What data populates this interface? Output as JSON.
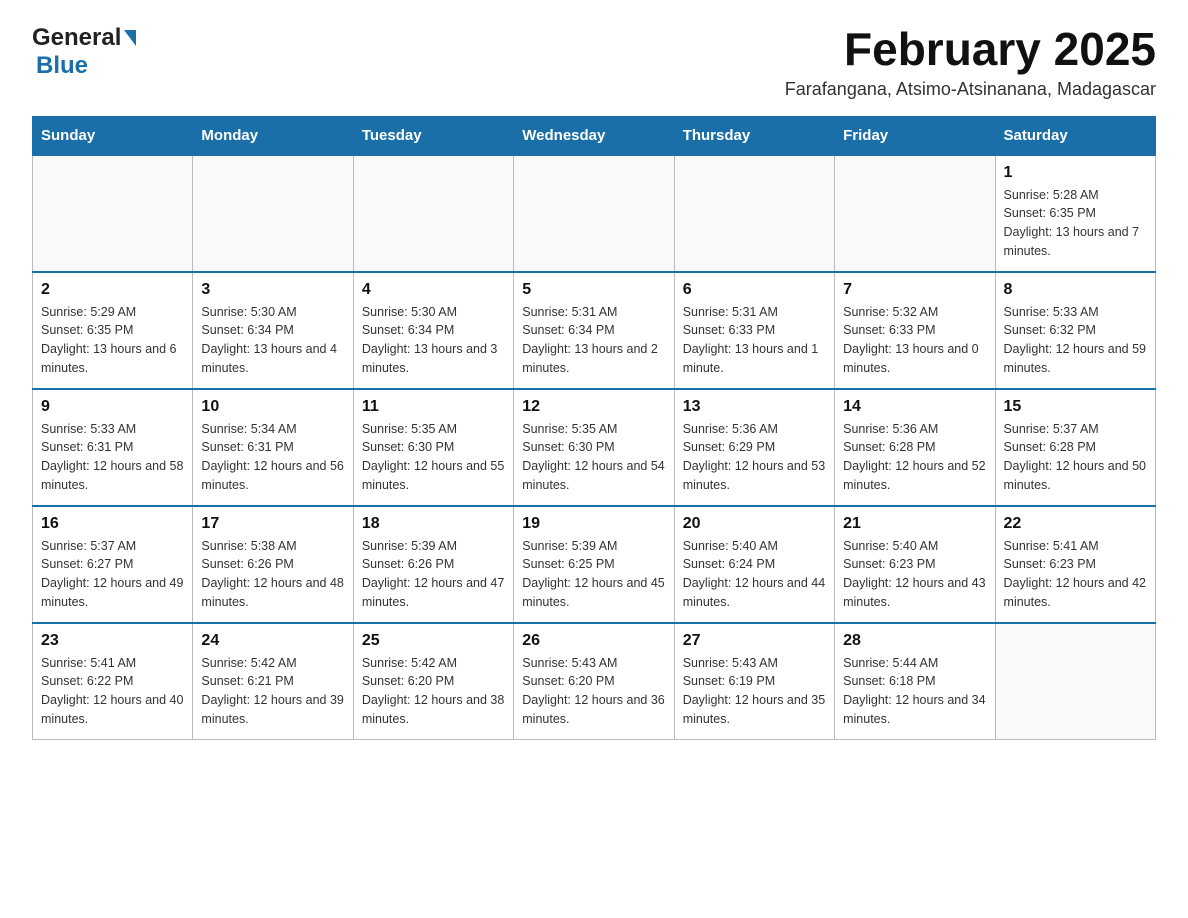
{
  "header": {
    "logo_general": "General",
    "logo_blue": "Blue",
    "month_title": "February 2025",
    "location": "Farafangana, Atsimo-Atsinanana, Madagascar"
  },
  "days_of_week": [
    "Sunday",
    "Monday",
    "Tuesday",
    "Wednesday",
    "Thursday",
    "Friday",
    "Saturday"
  ],
  "weeks": [
    [
      {
        "day": "",
        "info": ""
      },
      {
        "day": "",
        "info": ""
      },
      {
        "day": "",
        "info": ""
      },
      {
        "day": "",
        "info": ""
      },
      {
        "day": "",
        "info": ""
      },
      {
        "day": "",
        "info": ""
      },
      {
        "day": "1",
        "info": "Sunrise: 5:28 AM\nSunset: 6:35 PM\nDaylight: 13 hours and 7 minutes."
      }
    ],
    [
      {
        "day": "2",
        "info": "Sunrise: 5:29 AM\nSunset: 6:35 PM\nDaylight: 13 hours and 6 minutes."
      },
      {
        "day": "3",
        "info": "Sunrise: 5:30 AM\nSunset: 6:34 PM\nDaylight: 13 hours and 4 minutes."
      },
      {
        "day": "4",
        "info": "Sunrise: 5:30 AM\nSunset: 6:34 PM\nDaylight: 13 hours and 3 minutes."
      },
      {
        "day": "5",
        "info": "Sunrise: 5:31 AM\nSunset: 6:34 PM\nDaylight: 13 hours and 2 minutes."
      },
      {
        "day": "6",
        "info": "Sunrise: 5:31 AM\nSunset: 6:33 PM\nDaylight: 13 hours and 1 minute."
      },
      {
        "day": "7",
        "info": "Sunrise: 5:32 AM\nSunset: 6:33 PM\nDaylight: 13 hours and 0 minutes."
      },
      {
        "day": "8",
        "info": "Sunrise: 5:33 AM\nSunset: 6:32 PM\nDaylight: 12 hours and 59 minutes."
      }
    ],
    [
      {
        "day": "9",
        "info": "Sunrise: 5:33 AM\nSunset: 6:31 PM\nDaylight: 12 hours and 58 minutes."
      },
      {
        "day": "10",
        "info": "Sunrise: 5:34 AM\nSunset: 6:31 PM\nDaylight: 12 hours and 56 minutes."
      },
      {
        "day": "11",
        "info": "Sunrise: 5:35 AM\nSunset: 6:30 PM\nDaylight: 12 hours and 55 minutes."
      },
      {
        "day": "12",
        "info": "Sunrise: 5:35 AM\nSunset: 6:30 PM\nDaylight: 12 hours and 54 minutes."
      },
      {
        "day": "13",
        "info": "Sunrise: 5:36 AM\nSunset: 6:29 PM\nDaylight: 12 hours and 53 minutes."
      },
      {
        "day": "14",
        "info": "Sunrise: 5:36 AM\nSunset: 6:28 PM\nDaylight: 12 hours and 52 minutes."
      },
      {
        "day": "15",
        "info": "Sunrise: 5:37 AM\nSunset: 6:28 PM\nDaylight: 12 hours and 50 minutes."
      }
    ],
    [
      {
        "day": "16",
        "info": "Sunrise: 5:37 AM\nSunset: 6:27 PM\nDaylight: 12 hours and 49 minutes."
      },
      {
        "day": "17",
        "info": "Sunrise: 5:38 AM\nSunset: 6:26 PM\nDaylight: 12 hours and 48 minutes."
      },
      {
        "day": "18",
        "info": "Sunrise: 5:39 AM\nSunset: 6:26 PM\nDaylight: 12 hours and 47 minutes."
      },
      {
        "day": "19",
        "info": "Sunrise: 5:39 AM\nSunset: 6:25 PM\nDaylight: 12 hours and 45 minutes."
      },
      {
        "day": "20",
        "info": "Sunrise: 5:40 AM\nSunset: 6:24 PM\nDaylight: 12 hours and 44 minutes."
      },
      {
        "day": "21",
        "info": "Sunrise: 5:40 AM\nSunset: 6:23 PM\nDaylight: 12 hours and 43 minutes."
      },
      {
        "day": "22",
        "info": "Sunrise: 5:41 AM\nSunset: 6:23 PM\nDaylight: 12 hours and 42 minutes."
      }
    ],
    [
      {
        "day": "23",
        "info": "Sunrise: 5:41 AM\nSunset: 6:22 PM\nDaylight: 12 hours and 40 minutes."
      },
      {
        "day": "24",
        "info": "Sunrise: 5:42 AM\nSunset: 6:21 PM\nDaylight: 12 hours and 39 minutes."
      },
      {
        "day": "25",
        "info": "Sunrise: 5:42 AM\nSunset: 6:20 PM\nDaylight: 12 hours and 38 minutes."
      },
      {
        "day": "26",
        "info": "Sunrise: 5:43 AM\nSunset: 6:20 PM\nDaylight: 12 hours and 36 minutes."
      },
      {
        "day": "27",
        "info": "Sunrise: 5:43 AM\nSunset: 6:19 PM\nDaylight: 12 hours and 35 minutes."
      },
      {
        "day": "28",
        "info": "Sunrise: 5:44 AM\nSunset: 6:18 PM\nDaylight: 12 hours and 34 minutes."
      },
      {
        "day": "",
        "info": ""
      }
    ]
  ]
}
